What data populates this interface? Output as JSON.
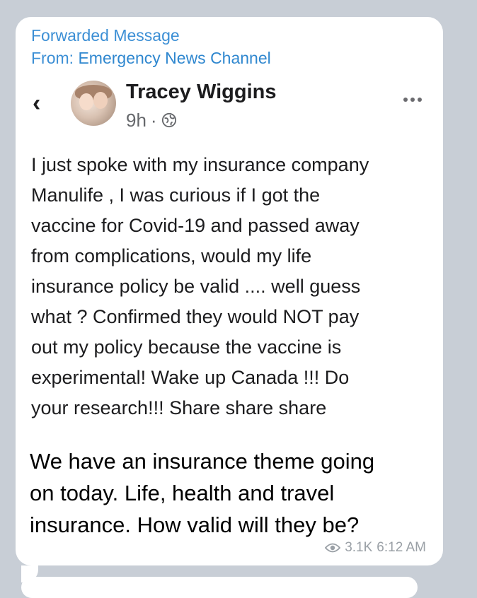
{
  "forward": {
    "title": "Forwarded Message",
    "from_label": "From: ",
    "from_name": "Emergency News Channel"
  },
  "post": {
    "author": "Tracey Wiggins",
    "time": "9h",
    "dot": "·",
    "back_icon": "chevron-left-icon",
    "privacy_icon": "globe-icon",
    "more_icon": "more-horizontal-icon",
    "text": "I just spoke with my insurance company\nManulife , I was curious if I got the\nvaccine for Covid-19 and passed away\nfrom complications, would my life\ninsurance policy be valid .... well guess\nwhat ? Confirmed they would NOT pay\nout my policy because the vaccine is\nexperimental!  Wake up Canada !!! Do\nyour research!!! Share share share"
  },
  "message": {
    "caption": "We have an insurance theme going\non today. Life, health and travel\ninsurance. How valid will they be?",
    "views": "3.1K",
    "time": "6:12 AM",
    "views_icon": "eye-icon"
  }
}
